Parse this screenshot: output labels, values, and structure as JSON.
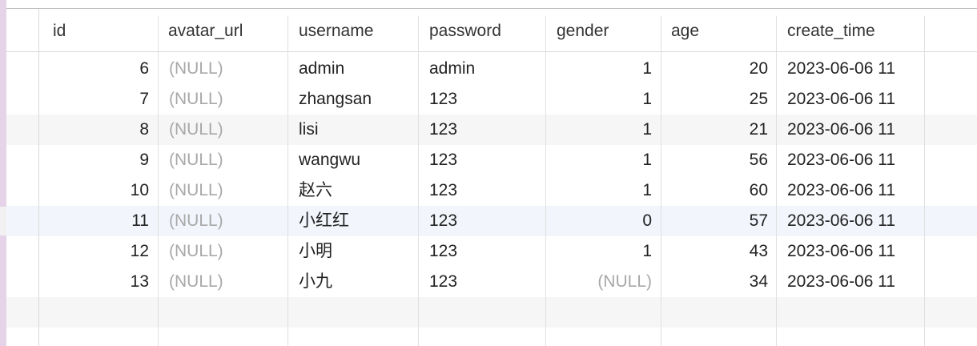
{
  "table": {
    "columns": [
      "id",
      "avatar_url",
      "username",
      "password",
      "gender",
      "age",
      "create_time"
    ],
    "rows": [
      [
        "6",
        "(NULL)",
        "admin",
        "admin",
        "1",
        "20",
        "2023-06-06 11"
      ],
      [
        "7",
        "(NULL)",
        "zhangsan",
        "123",
        "1",
        "25",
        "2023-06-06 11"
      ],
      [
        "8",
        "(NULL)",
        "lisi",
        "123",
        "1",
        "21",
        "2023-06-06 11"
      ],
      [
        "9",
        "(NULL)",
        "wangwu",
        "123",
        "1",
        "56",
        "2023-06-06 11"
      ],
      [
        "10",
        "(NULL)",
        "赵六",
        "123",
        "1",
        "60",
        "2023-06-06 11"
      ],
      [
        "11",
        "(NULL)",
        "小红红",
        "123",
        "0",
        "57",
        "2023-06-06 11"
      ],
      [
        "12",
        "(NULL)",
        "小明",
        "123",
        "1",
        "43",
        "2023-06-06 11"
      ],
      [
        "13",
        "(NULL)",
        "小九",
        "123",
        "(NULL)",
        "34",
        "2023-06-06 11"
      ]
    ]
  }
}
